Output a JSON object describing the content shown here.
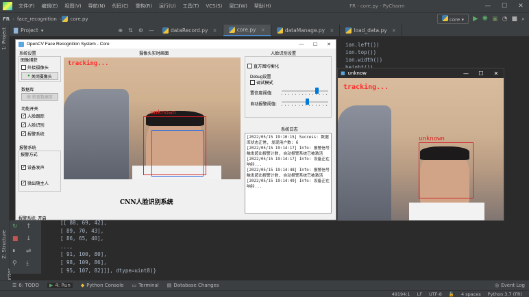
{
  "menu": {
    "items": [
      "文件(F)",
      "编辑(E)",
      "视图(V)",
      "导航(N)",
      "代码(C)",
      "重构(R)",
      "运行(U)",
      "工具(T)",
      "VCS(S)",
      "窗口(W)",
      "帮助(H)"
    ],
    "window_title": "FR - core.py - PyCharm"
  },
  "nav": {
    "project": "FR",
    "folder": "face_recognition",
    "file": "core.py",
    "run_config": "core"
  },
  "sidebar": {
    "project_label": "1: Project",
    "structure_label": "Z: Structure",
    "favorites_label": "2: Favorites"
  },
  "project_panel": {
    "title": "Project"
  },
  "tabs": [
    {
      "label": "dataRecord.py",
      "active": false
    },
    {
      "label": "core.py",
      "active": true
    },
    {
      "label": "dataManage.py",
      "active": false
    },
    {
      "label": "load_data.py",
      "active": false
    }
  ],
  "code_lines": [
    "ion.left())",
    "ion.top())",
    "ion.width())",
    "height())"
  ],
  "console_lines": [
    "[[ 88,  69,  42],",
    " [ 89,  70,  43],",
    " [ 86,  65,  40],",
    " ...,",
    " [ 91, 100,  80],",
    " [ 98, 109,  86],",
    " [ 95, 107,  82]]], dtype=uint8)}"
  ],
  "bottom_tools": [
    {
      "label": "6: TODO",
      "icon": "todo-icon"
    },
    {
      "label": "4: Run",
      "icon": "run-icon"
    },
    {
      "label": "Python Console",
      "icon": "python-console-icon"
    },
    {
      "label": "Terminal",
      "icon": "terminal-icon"
    },
    {
      "label": "Database Changes",
      "icon": "database-icon"
    }
  ],
  "event_log": "Event Log",
  "status": {
    "position": "49194:1",
    "line_sep": "LF",
    "encoding": "UTF-8",
    "indent": "4 spaces",
    "interpreter": "Python 3.7 (FR)"
  },
  "qt": {
    "title": "OpenCV Face Recognition System - Core",
    "system_settings": "系统设置",
    "image_capture": "图像捕获",
    "external_camera": "外接摄像头",
    "close_camera_btn": "关闭摄像头",
    "database": "数据库",
    "check_db_btn": "检查数据库",
    "features": "功能开关",
    "face_tracking": "人脸跟踪",
    "face_recognition": "人脸识别",
    "alarm_system": "报警系统",
    "alarm_section": "报警系统",
    "alarm_method": "报警方式",
    "device_sound": "设备发声",
    "notify_owner": "微出随主人",
    "alarm_status": "报警系统: 开启",
    "camera_title": "摄像头实时画面",
    "tracking_text": "tracking...",
    "unknown_text": "unknown",
    "caption": "CNN人脸识别系统",
    "recognition_settings": "人脸识别设置",
    "histogram_eq": "直方图均衡化",
    "debug_settings": "Debug设置",
    "debug_mode": "调试模式",
    "confidence_threshold": "置信度阈值:",
    "auto_alarm_threshold": "自动报警阈值:",
    "confidence_value": 0.75,
    "alarm_threshold_value": 0.55,
    "log_title": "系统日志",
    "log_entries": [
      "[2022/05/15 19:10:15] Success: 数据库状态正常, 发现用户数: 6",
      "[2022/05/15 19:14:17] Info: 报警信号触发超出报警计数, 自动报警系统已被激活",
      "[2022/05/15 19:14:17] Info: 设备正在响铃...",
      "[2022/05/15 19:14:48] Info: 报警信号触发超出报警计数, 自动报警系统已被激活",
      "[2022/05/15 19:14:49] Info: 设备正在响铃..."
    ]
  },
  "cv_window": {
    "title": "unknow",
    "tracking_text": "tracking...",
    "unknown_text": "unknown"
  },
  "colors": {
    "ide_bg": "#2b2b2b",
    "ide_panel": "#3c3f41",
    "accent": "#4a88c7",
    "track_red": "#ff2a2a"
  }
}
